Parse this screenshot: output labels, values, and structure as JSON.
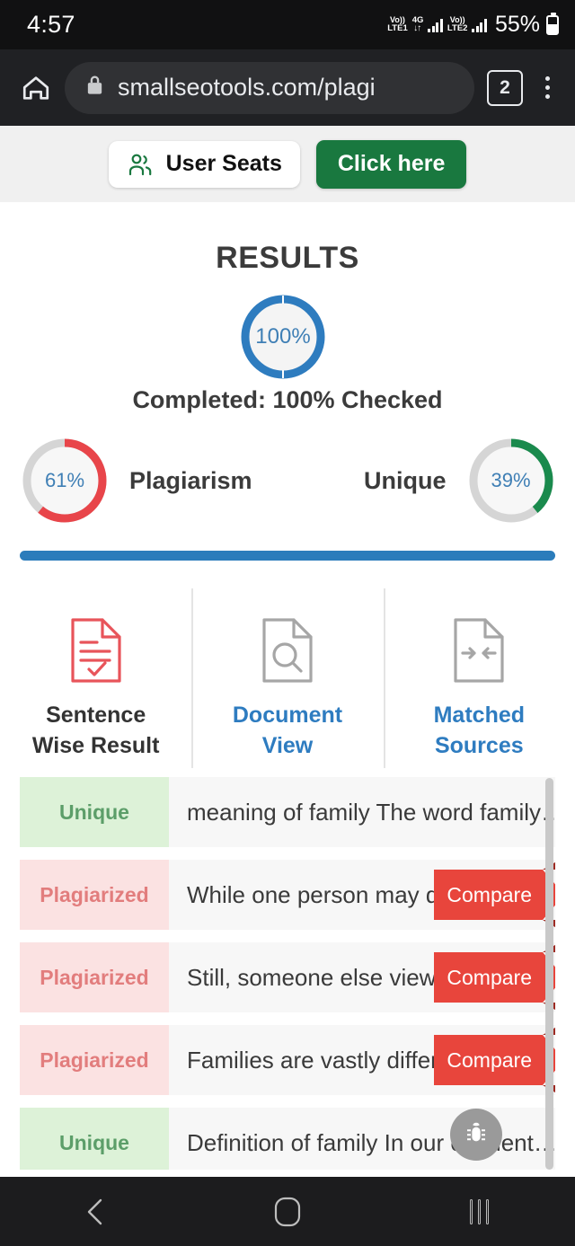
{
  "statusbar": {
    "time": "4:57",
    "sim1_volte": "Vo))",
    "sim1_net": "LTE1",
    "data_arrows": "↓↑",
    "network_type": "4G",
    "sim2_volte": "Vo))",
    "sim2_net": "LTE2",
    "battery": "55%"
  },
  "browser": {
    "home_icon": "home-icon",
    "lock_icon": "lock-icon",
    "url": "smallseotools.com/plagi",
    "tab_count": "2",
    "menu_icon": "kebab-menu-icon"
  },
  "promo": {
    "seats_icon": "users-icon",
    "seats_label": "User Seats",
    "cta_label": "Click here",
    "cta_color": "#19783f"
  },
  "results": {
    "title": "RESULTS",
    "overall": {
      "value": "100%",
      "percent": 100,
      "color": "#2e7cbf",
      "track": "#f4f4f4"
    },
    "completed_text": "Completed: 100% Checked",
    "plagiarism": {
      "value": "61%",
      "percent": 61,
      "label": "Plagiarism",
      "color": "#e8454a",
      "track": "#d5d5d5"
    },
    "unique": {
      "value": "39%",
      "percent": 39,
      "label": "Unique",
      "color": "#1a8a4d",
      "track": "#d5d5d5"
    },
    "divider_color": "#2b7cbb"
  },
  "tabs": [
    {
      "label": "Sentence\nWise Result",
      "label_line1": "Sentence",
      "label_line2": "Wise Result",
      "icon": "document-check-icon",
      "active": true,
      "color": "#333333",
      "icon_color": "#e8545a"
    },
    {
      "label_line1": "Document",
      "label_line2": "View",
      "icon": "document-search-icon",
      "active": false,
      "color": "#2e7cc0",
      "icon_color": "#a6a6a6"
    },
    {
      "label_line1": "Matched",
      "label_line2": "Sources",
      "icon": "document-arrows-icon",
      "active": false,
      "color": "#2e7cc0",
      "icon_color": "#a6a6a6"
    }
  ],
  "sentences": [
    {
      "status": "Unique",
      "type": "unique",
      "text": "meaning of family The word family…",
      "compare": null
    },
    {
      "status": "Plagiarized",
      "type": "plagiarized",
      "text": "While one person may define f…",
      "compare": "Compare"
    },
    {
      "status": "Plagiarized",
      "type": "plagiarized",
      "text": "Still, someone else views their…",
      "compare": "Compare"
    },
    {
      "status": "Plagiarized",
      "type": "plagiarized",
      "text": "Families are vastly different, b…",
      "compare": "Compare"
    },
    {
      "status": "Unique",
      "type": "unique",
      "text": "Definition of family In our element…",
      "compare": null
    }
  ],
  "colors": {
    "unique_bg": "#ddf2d8",
    "unique_text": "#5c9e69",
    "plag_bg": "#fbe2e2",
    "plag_text": "#e27d7d",
    "compare_bg": "#e8453c",
    "compare_fold": "#9e2b24",
    "row_bg": "#f7f7f7"
  },
  "fab": {
    "icon": "bug-icon"
  },
  "navbar": {
    "back_icon": "back-chevron-icon",
    "home_icon": "home-square-icon",
    "recents_icon": "recents-bars-icon"
  }
}
